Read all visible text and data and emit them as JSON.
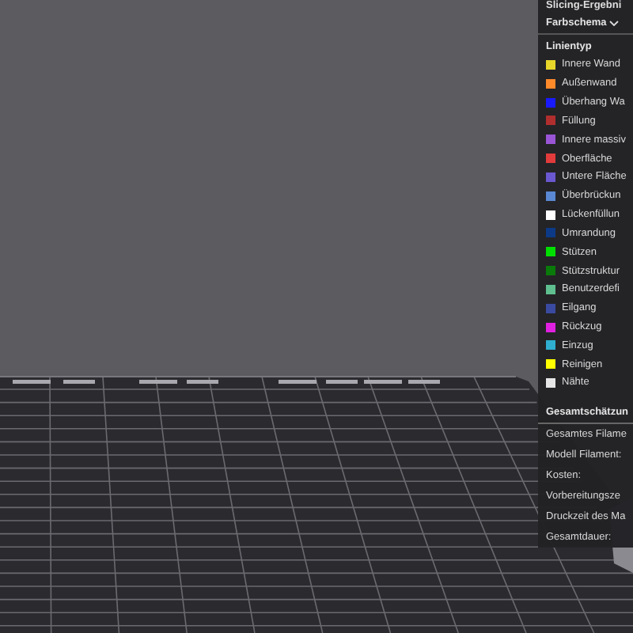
{
  "panel": {
    "title": "Slicing-Ergebni",
    "color_scheme_label": "Farbschema",
    "legend_heading": "Linientyp",
    "legend": [
      {
        "label": "Innere Wand",
        "color": "#e8d62a"
      },
      {
        "label": "Außenwand",
        "color": "#ff8a2a"
      },
      {
        "label": "Überhang Wa",
        "color": "#1a1aff"
      },
      {
        "label": "Füllung",
        "color": "#b02e2e"
      },
      {
        "label": "Innere massiv",
        "color": "#9a55d6"
      },
      {
        "label": "Oberfläche",
        "color": "#e23b3b"
      },
      {
        "label": "Untere Fläche",
        "color": "#6a58d0"
      },
      {
        "label": "Überbrückun",
        "color": "#5a88d2"
      },
      {
        "label": "Lückenfüllun",
        "color": "#ffffff"
      },
      {
        "label": "Umrandung",
        "color": "#0c3a86"
      },
      {
        "label": "Stützen",
        "color": "#00e000"
      },
      {
        "label": "Stützstruktur",
        "color": "#0a7a0a"
      },
      {
        "label": "Benutzerdefi",
        "color": "#5fbf8f"
      },
      {
        "label": "Eilgang",
        "color": "#3a4aa0"
      },
      {
        "label": "Rückzug",
        "color": "#e020e0"
      },
      {
        "label": "Einzug",
        "color": "#30aed0"
      },
      {
        "label": "Reinigen",
        "color": "#ffff00"
      },
      {
        "label": "Nähte",
        "color": "#e6e6e6"
      }
    ],
    "estimate_heading": "Gesamtschätzun",
    "estimates": [
      "Gesamtes Filame",
      "Modell Filament:",
      "Kosten:",
      "Vorbereitungsze",
      "Druckzeit des Ma",
      "Gesamtdauer:"
    ]
  }
}
